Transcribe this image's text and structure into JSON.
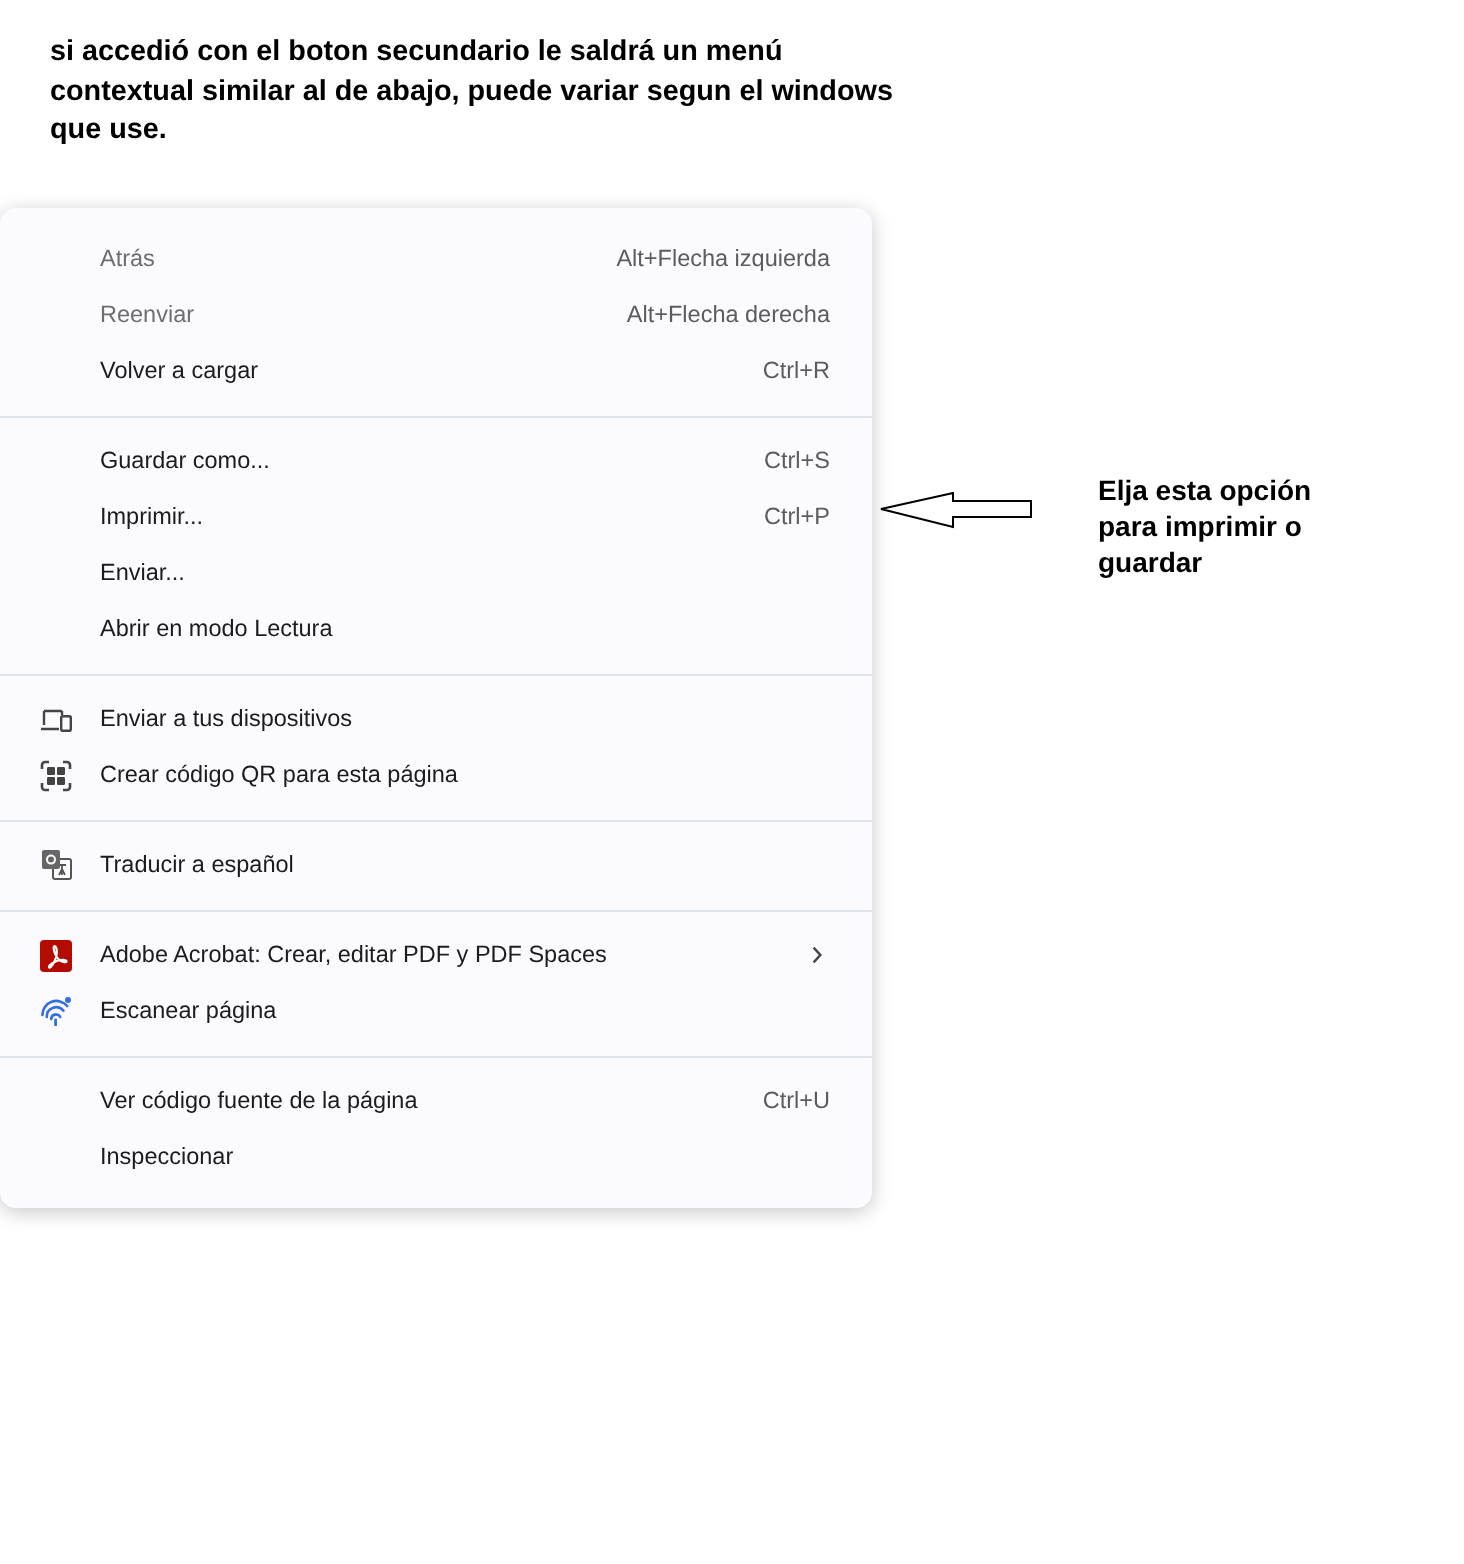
{
  "note": {
    "text": "si accedió con el boton secundario le saldrá un menú contextual similar al de abajo, puede variar segun el windows que use."
  },
  "context_menu": {
    "groups": [
      {
        "items": [
          {
            "label": "Atrás",
            "shortcut": "Alt+Flecha izquierda",
            "disabled": true,
            "submenu": false
          },
          {
            "label": "Reenviar",
            "shortcut": "Alt+Flecha derecha",
            "disabled": true,
            "submenu": false
          },
          {
            "label": "Volver a cargar",
            "shortcut": "Ctrl+R",
            "disabled": false,
            "submenu": false
          }
        ]
      },
      {
        "items": [
          {
            "label": "Guardar como...",
            "shortcut": "Ctrl+S",
            "disabled": false,
            "submenu": false
          },
          {
            "label": "Imprimir...",
            "shortcut": "Ctrl+P",
            "disabled": false,
            "submenu": false
          },
          {
            "label": "Enviar...",
            "disabled": false,
            "submenu": false
          },
          {
            "label": "Abrir en modo Lectura",
            "disabled": false,
            "submenu": false
          }
        ]
      },
      {
        "items": [
          {
            "label": "Enviar a tus dispositivos",
            "disabled": false,
            "submenu": false
          },
          {
            "label": "Crear código QR para esta página",
            "disabled": false,
            "submenu": false
          }
        ]
      },
      {
        "items": [
          {
            "label": "Traducir a español",
            "disabled": false,
            "submenu": false
          }
        ]
      },
      {
        "items": [
          {
            "label": "Adobe Acrobat: Crear, editar PDF y PDF Spaces",
            "disabled": false,
            "submenu": true
          },
          {
            "label": "Escanear página",
            "disabled": false,
            "submenu": false
          }
        ]
      },
      {
        "items": [
          {
            "label": "Ver código fuente de la página",
            "shortcut": "Ctrl+U",
            "disabled": false,
            "submenu": false
          },
          {
            "label": "Inspeccionar",
            "disabled": false,
            "submenu": false
          }
        ]
      }
    ]
  },
  "callout": {
    "text": "Elja esta opción para imprimir o guardar"
  }
}
